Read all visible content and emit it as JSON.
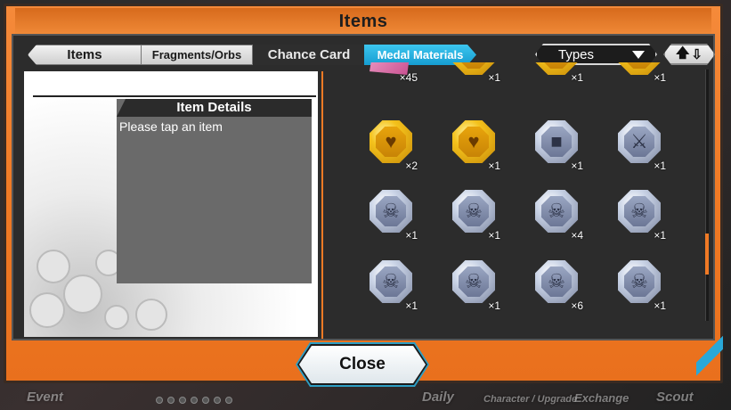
{
  "window": {
    "title": "Items"
  },
  "tabs": [
    {
      "label": "Items"
    },
    {
      "label": "Fragments/Orbs"
    },
    {
      "label": "Chance Card"
    },
    {
      "label": "Medal Materials",
      "active": true
    }
  ],
  "filter": {
    "types_label": "Types",
    "sort_icon": "up-down-arrows-icon"
  },
  "details": {
    "heading": "Item Details",
    "placeholder": "Please tap an item"
  },
  "items": [
    {
      "icon": "character-fragment-icon",
      "style": "pink",
      "quantity": "×45"
    },
    {
      "icon": "heart-medal-icon",
      "style": "gold",
      "quantity": "×1"
    },
    {
      "icon": "armor-medal-icon",
      "style": "gold",
      "quantity": "×1"
    },
    {
      "icon": "armor-medal-icon",
      "style": "gold",
      "quantity": "×1"
    },
    {
      "icon": "heart-medal-icon",
      "style": "gold",
      "quantity": "×2"
    },
    {
      "icon": "heart-medal-icon",
      "style": "gold",
      "quantity": "×1"
    },
    {
      "icon": "armor-medal-icon",
      "style": "silver",
      "quantity": "×1"
    },
    {
      "icon": "sword-medal-icon",
      "style": "silver",
      "quantity": "×1"
    },
    {
      "icon": "skull-medal-icon",
      "style": "silver",
      "quantity": "×1"
    },
    {
      "icon": "skull-medal-icon",
      "style": "silver",
      "quantity": "×1"
    },
    {
      "icon": "skull-medal-icon",
      "style": "silver",
      "quantity": "×4"
    },
    {
      "icon": "skull-medal-icon",
      "style": "silver",
      "quantity": "×1"
    },
    {
      "icon": "skull-medal-icon",
      "style": "silver",
      "quantity": "×1"
    },
    {
      "icon": "skull-medal-icon",
      "style": "silver",
      "quantity": "×1"
    },
    {
      "icon": "skull-medal-icon",
      "style": "silver",
      "quantity": "×6"
    },
    {
      "icon": "skull-medal-icon",
      "style": "silver",
      "quantity": "×1"
    }
  ],
  "close_label": "Close",
  "background_menu": {
    "event": "Event",
    "daily": "Daily",
    "character_upgrade": "Character / Upgrade",
    "exchange": "Exchange",
    "scout": "Scout"
  },
  "colors": {
    "frame": "#f07a25",
    "active_tab": "#1ea7dc",
    "panel": "#2c2c2c"
  }
}
